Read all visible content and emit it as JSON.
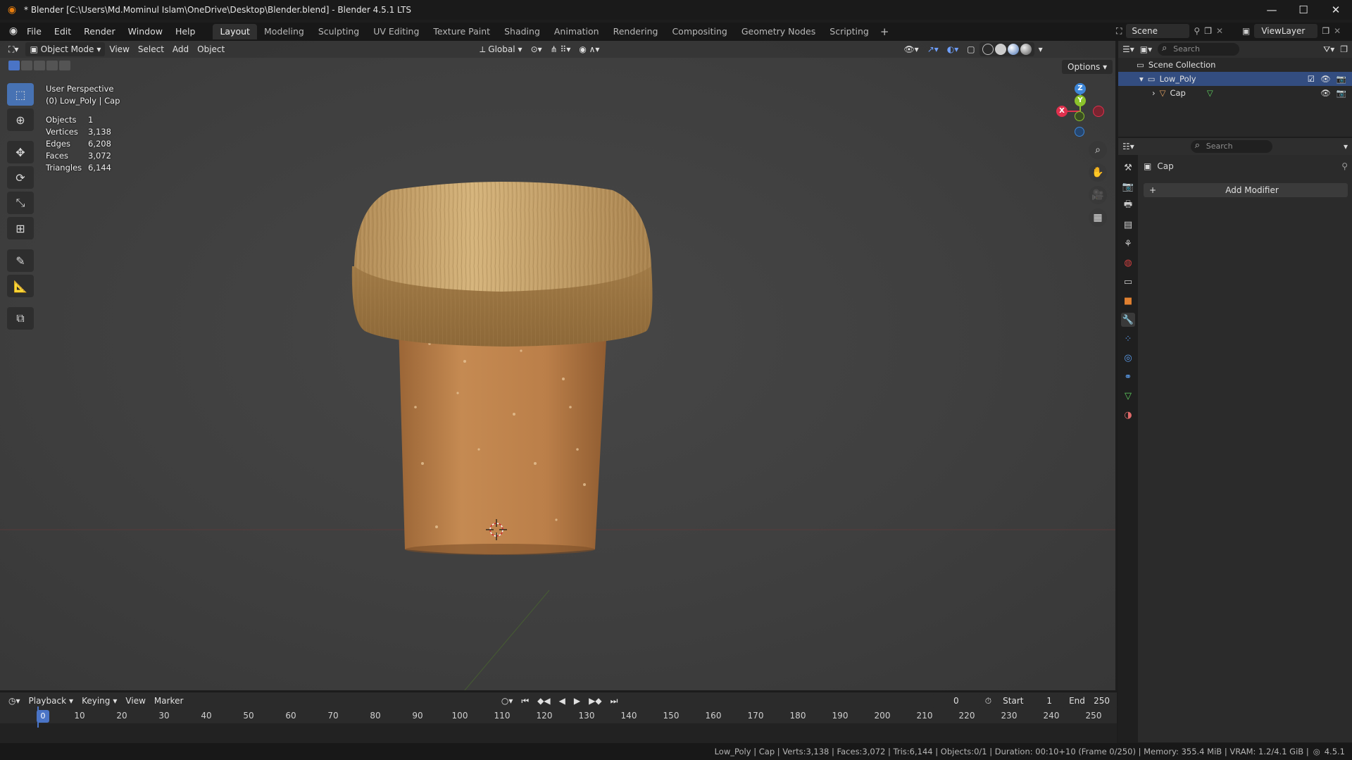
{
  "window": {
    "title": "* Blender [C:\\Users\\Md.Mominul Islam\\OneDrive\\Desktop\\Blender.blend] - Blender 4.5.1 LTS"
  },
  "menu": {
    "items": [
      "File",
      "Edit",
      "Render",
      "Window",
      "Help"
    ]
  },
  "workspaces": {
    "tabs": [
      "Layout",
      "Modeling",
      "Sculpting",
      "UV Editing",
      "Texture Paint",
      "Shading",
      "Animation",
      "Rendering",
      "Compositing",
      "Geometry Nodes",
      "Scripting"
    ],
    "active": "Layout"
  },
  "scene": {
    "label": "Scene",
    "view_layer": "ViewLayer"
  },
  "viewport": {
    "mode": "Object Mode",
    "menus": [
      "View",
      "Select",
      "Add",
      "Object"
    ],
    "orientation": "Global",
    "options_label": "Options",
    "overlay": {
      "view_name": "User Perspective",
      "context": "(0) Low_Poly | Cap",
      "stats": [
        {
          "k": "Objects",
          "v": "1"
        },
        {
          "k": "Vertices",
          "v": "3,138"
        },
        {
          "k": "Edges",
          "v": "6,208"
        },
        {
          "k": "Faces",
          "v": "3,072"
        },
        {
          "k": "Triangles",
          "v": "6,144"
        }
      ]
    },
    "gizmo": {
      "x": "X",
      "y": "Y",
      "z": "Z",
      "x_color": "#e0304d",
      "y_color": "#8bc32b",
      "z_color": "#3d86d8"
    }
  },
  "timeline": {
    "menus": [
      "Playback",
      "Keying",
      "View",
      "Marker"
    ],
    "current_frame": "0",
    "start_label": "Start",
    "start": "1",
    "end_label": "End",
    "end": "250",
    "ticks": [
      "0",
      "10",
      "20",
      "30",
      "40",
      "50",
      "60",
      "70",
      "80",
      "90",
      "100",
      "110",
      "120",
      "130",
      "140",
      "150",
      "160",
      "170",
      "180",
      "190",
      "200",
      "210",
      "220",
      "230",
      "240",
      "250"
    ]
  },
  "outliner": {
    "search_placeholder": "Search",
    "root": "Scene Collection",
    "collection": "Low_Poly",
    "object": "Cap"
  },
  "properties": {
    "search_placeholder": "Search",
    "object_name": "Cap",
    "add_modifier": "Add Modifier"
  },
  "statusbar": {
    "text": "Low_Poly | Cap | Verts:3,138 | Faces:3,072 | Tris:6,144 | Objects:0/1 | Duration: 00:10+10 (Frame 0/250) | Memory: 355.4 MiB | VRAM: 1.2/4.1 GiB |",
    "version": "4.5.1"
  },
  "colors": {
    "accent": "#4772b3",
    "selection": "#334d80",
    "cork_cap": "#c9a66b",
    "cork_body": "#b57a45"
  }
}
